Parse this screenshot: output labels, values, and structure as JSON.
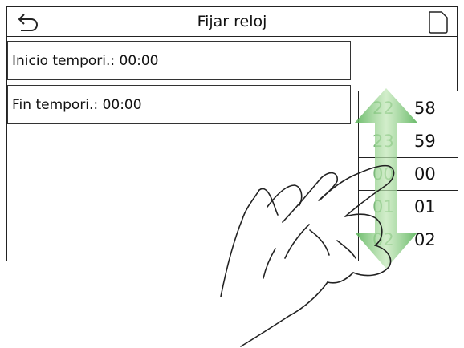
{
  "header": {
    "title": "Fijar reloj"
  },
  "rows": {
    "start": "Inicio tempori.: 00:00",
    "end": "Fin tempori.: 00:00"
  },
  "picker": {
    "hours": [
      "22",
      "23",
      "00",
      "01",
      "02"
    ],
    "minutes": [
      "58",
      "59",
      "00",
      "01",
      "02"
    ],
    "selected_hour": "00",
    "selected_minute": "00"
  },
  "colors": {
    "arrow": "#5cb85c",
    "hour_text": "#7cb87c"
  },
  "icons": {
    "back": "back-arrow-icon",
    "document": "document-icon",
    "gesture": "swipe-hand-icon"
  }
}
